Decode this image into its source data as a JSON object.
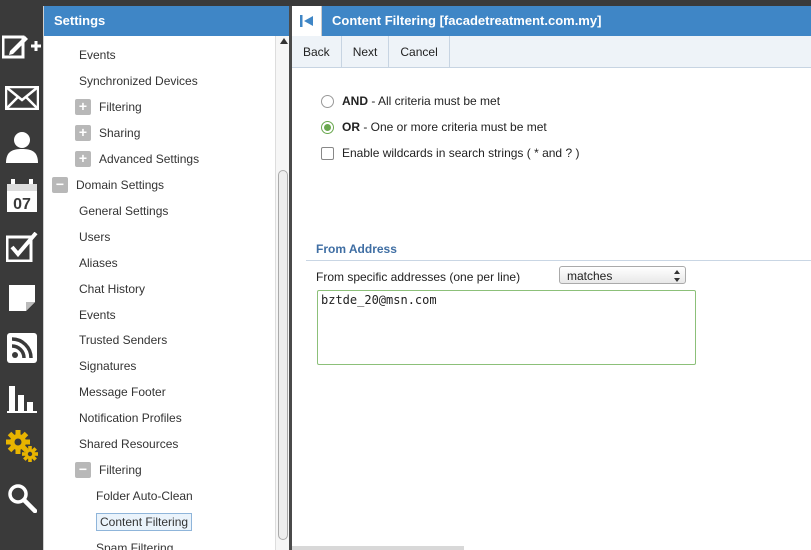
{
  "rail": {
    "icons": [
      "compose-icon",
      "mail-icon",
      "contacts-icon",
      "calendar-icon",
      "tasks-icon",
      "notes-icon",
      "rss-icon",
      "reports-icon",
      "settings-icon",
      "search-icon"
    ],
    "calendar_day": "07",
    "accent": "#e8b400"
  },
  "settings": {
    "title": "Settings",
    "tree": [
      {
        "label": "Events",
        "indent": 1,
        "toggle": ""
      },
      {
        "label": "Synchronized Devices",
        "indent": 1,
        "toggle": ""
      },
      {
        "label": "Filtering",
        "indent": 1,
        "toggle": "+"
      },
      {
        "label": "Sharing",
        "indent": 1,
        "toggle": "+"
      },
      {
        "label": "Advanced Settings",
        "indent": 1,
        "toggle": "+"
      },
      {
        "label": "Domain Settings",
        "indent": 0,
        "toggle": "−"
      },
      {
        "label": "General Settings",
        "indent": 1,
        "toggle": ""
      },
      {
        "label": "Users",
        "indent": 1,
        "toggle": ""
      },
      {
        "label": "Aliases",
        "indent": 1,
        "toggle": ""
      },
      {
        "label": "Chat History",
        "indent": 1,
        "toggle": ""
      },
      {
        "label": "Events",
        "indent": 1,
        "toggle": ""
      },
      {
        "label": "Trusted Senders",
        "indent": 1,
        "toggle": ""
      },
      {
        "label": "Signatures",
        "indent": 1,
        "toggle": ""
      },
      {
        "label": "Message Footer",
        "indent": 1,
        "toggle": ""
      },
      {
        "label": "Notification Profiles",
        "indent": 1,
        "toggle": ""
      },
      {
        "label": "Shared Resources",
        "indent": 1,
        "toggle": ""
      },
      {
        "label": "Filtering",
        "indent": 1,
        "toggle": "−"
      },
      {
        "label": "Folder Auto-Clean",
        "indent": 2,
        "toggle": ""
      },
      {
        "label": "Content Filtering",
        "indent": 2,
        "toggle": "",
        "selected": true
      },
      {
        "label": "Spam Filtering",
        "indent": 2,
        "toggle": ""
      }
    ]
  },
  "content": {
    "title": "Content Filtering [facadetreatment.com.my]",
    "toolbar": {
      "back": "Back",
      "next": "Next",
      "cancel": "Cancel"
    },
    "criteria": {
      "and_bold": "AND",
      "and_text": " - All criteria must be met",
      "or_bold": "OR",
      "or_text": " - One or more criteria must be met",
      "selected": "OR",
      "wildcards": "Enable wildcards in search strings ( * and ? )",
      "wildcards_checked": false
    },
    "from_address": {
      "section_title": "From Address",
      "label": "From specific addresses (one per line)",
      "match_mode": "matches",
      "value": "bztde_20@msn.com"
    }
  },
  "colors": {
    "header_blue": "#3f86c6",
    "section_blue": "#3f6ea3",
    "rail_bg": "#3a3a3a",
    "radio_green": "#6aa84f"
  }
}
